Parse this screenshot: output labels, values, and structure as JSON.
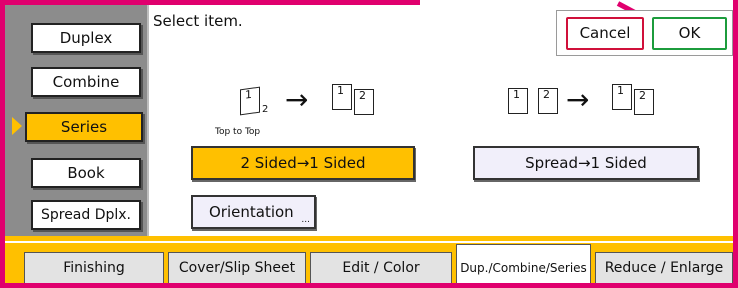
{
  "header": {
    "instruction": "Select item.",
    "cancel_label": "Cancel",
    "ok_label": "OK"
  },
  "side_menu": {
    "items": [
      {
        "label": "Duplex",
        "selected": false
      },
      {
        "label": "Combine",
        "selected": false
      },
      {
        "label": "Series",
        "selected": true
      },
      {
        "label": "Book",
        "selected": false
      },
      {
        "label": "Spread Dplx.",
        "selected": false
      }
    ]
  },
  "diagrams": {
    "left": {
      "page_a": "1",
      "page_a_sub": "2",
      "page_b1": "1",
      "page_b2": "2",
      "caption": "Top to Top"
    },
    "right": {
      "page_a1": "1",
      "page_a2": "2",
      "page_b1": "1",
      "page_b2": "2"
    },
    "arrow": "→"
  },
  "options": {
    "two_sided": "2 Sided→1 Sided",
    "spread": "Spread→1 Sided",
    "orientation": "Orientation",
    "orientation_more": "..."
  },
  "tabs": [
    {
      "label": "Finishing",
      "active": false
    },
    {
      "label": "Cover/Slip Sheet",
      "active": false
    },
    {
      "label": "Edit / Color",
      "active": false
    },
    {
      "label": "Dup./Combine/Series",
      "active": true
    },
    {
      "label": "Reduce / Enlarge",
      "active": false
    }
  ],
  "colors": {
    "accent_yellow": "#ffc000",
    "frame_magenta": "#e0006e",
    "cancel_border": "#d0103a",
    "ok_border": "#1c9c3c",
    "option_lavender": "#f1effa"
  }
}
